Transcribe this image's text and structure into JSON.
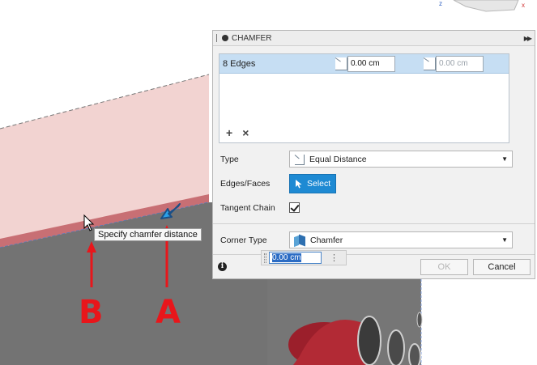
{
  "dialog": {
    "title": "CHAMFER",
    "edge_list": {
      "count_label": "8 Edges",
      "distance_value": "0.00 cm",
      "distance_value_2": "0.00 cm",
      "add_glyph": "+",
      "remove_glyph": "×"
    },
    "type": {
      "label": "Type",
      "value": "Equal Distance"
    },
    "edges_faces": {
      "label": "Edges/Faces",
      "button": "Select"
    },
    "tangent_chain": {
      "label": "Tangent Chain",
      "checked": true
    },
    "corner_type": {
      "label": "Corner Type",
      "value": "Chamfer"
    },
    "ok_label": "OK",
    "cancel_label": "Cancel",
    "info_glyph": "i"
  },
  "float_input": {
    "value": "0.00 cm"
  },
  "viewport": {
    "tooltip": "Specify chamfer distance",
    "annotations": {
      "a": "A",
      "b": "B"
    }
  },
  "colors": {
    "accent": "#1e8ad3",
    "selected_row": "#c6def3",
    "annotation_red": "#e8161b",
    "face_pink": "#f0cfcd",
    "body_grey": "#727272"
  }
}
